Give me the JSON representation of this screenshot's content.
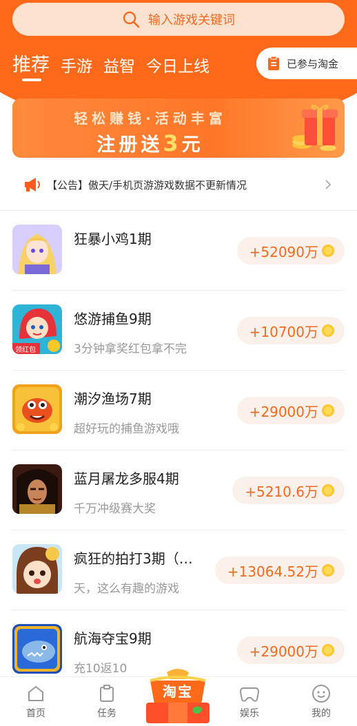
{
  "search": {
    "placeholder": "输入游戏关键词"
  },
  "tabs": [
    {
      "label": "推荐",
      "active": true
    },
    {
      "label": "手游",
      "active": false
    },
    {
      "label": "益智",
      "active": false
    },
    {
      "label": "今日上线",
      "active": false
    }
  ],
  "joined_button": {
    "label": "已参与淘金"
  },
  "banner": {
    "line1": "轻松赚钱·活动丰富",
    "line2_prefix": "注册送",
    "line2_highlight": "3",
    "line2_suffix": "元"
  },
  "notice": {
    "text": "【公告】傲天/手机页游游戏数据不更新情况"
  },
  "games": [
    {
      "title": "狂暴小鸡1期",
      "subtitle": "",
      "reward": "+52090万",
      "icon": "anime-girl-icon"
    },
    {
      "title": "悠游捕鱼9期",
      "subtitle": "3分钟拿奖红包拿不完",
      "reward": "+10700万",
      "icon": "mermaid-icon",
      "badge": "领红包"
    },
    {
      "title": "潮汐渔场7期",
      "subtitle": "超好玩的捕鱼游戏哦",
      "reward": "+29000万",
      "icon": "crab-icon"
    },
    {
      "title": "蓝月屠龙多服4期",
      "subtitle": "千万冲级赛大奖",
      "reward": "+5210.6万",
      "icon": "warrior-icon"
    },
    {
      "title": "疯狂的拍打3期（…",
      "subtitle": "天，这么有趣的游戏",
      "reward": "+13064.52万",
      "icon": "cartoon-girl-icon"
    },
    {
      "title": "航海夺宝9期",
      "subtitle": "充10返10",
      "reward": "+29000万",
      "icon": "shark-icon"
    }
  ],
  "bottom_nav": {
    "home": "首页",
    "tasks": "任务",
    "center": "淘宝",
    "fun": "娱乐",
    "mine": "我的"
  },
  "colors": {
    "accent": "#ff6a1a",
    "reward_text": "#f36b21",
    "reward_bg": "#fbf1ea"
  }
}
